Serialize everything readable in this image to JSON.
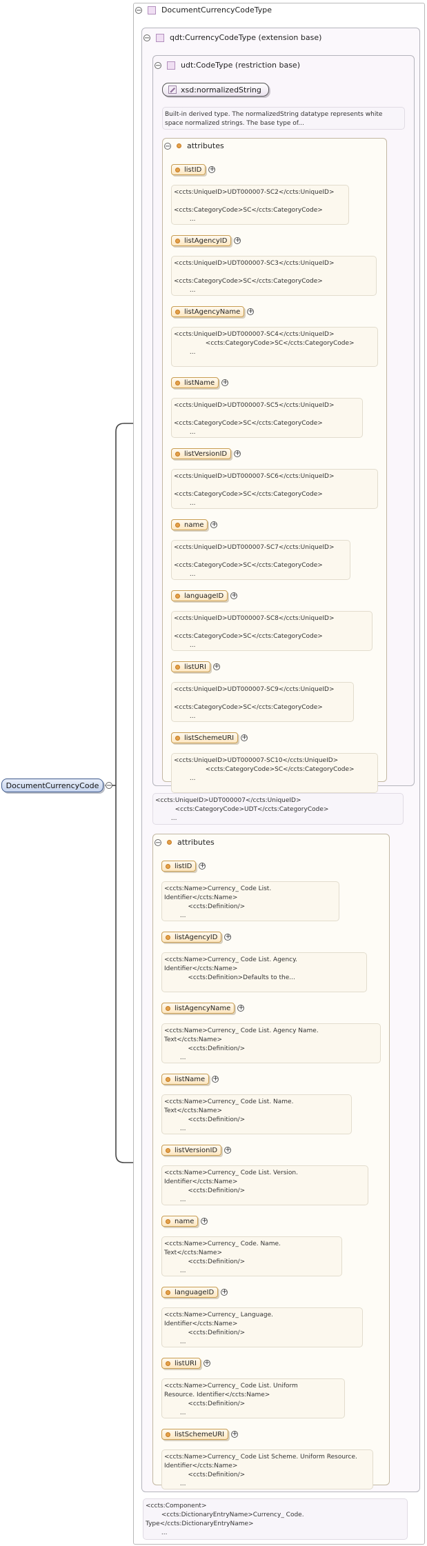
{
  "root": {
    "label": "DocumentCurrencyCode"
  },
  "main_type": {
    "label": "DocumentCurrencyCodeType"
  },
  "extension": {
    "label": "qdt:CurrencyCodeType (extension base)"
  },
  "restriction": {
    "label": "udt:CodeType (restriction base)"
  },
  "xsd": {
    "label": "xsd:normalizedString",
    "note": "Built-in derived type. The normalizedString datatype represents white\nspace normalized strings. The base type of..."
  },
  "inner_attributes": {
    "label": "attributes",
    "items": [
      {
        "name": "listID",
        "note": "<ccts:UniqueID>UDT000007-SC2</ccts:UniqueID>\n\n<ccts:CategoryCode>SC</ccts:CategoryCode>\n        ..."
      },
      {
        "name": "listAgencyID",
        "note": "<ccts:UniqueID>UDT000007-SC3</ccts:UniqueID>\n\n<ccts:CategoryCode>SC</ccts:CategoryCode>\n        ..."
      },
      {
        "name": "listAgencyName",
        "note": "<ccts:UniqueID>UDT000007-SC4</ccts:UniqueID>\n                <ccts:CategoryCode>SC</ccts:CategoryCode>\n        ..."
      },
      {
        "name": "listName",
        "note": "<ccts:UniqueID>UDT000007-SC5</ccts:UniqueID>\n\n<ccts:CategoryCode>SC</ccts:CategoryCode>\n        ..."
      },
      {
        "name": "listVersionID",
        "note": "<ccts:UniqueID>UDT000007-SC6</ccts:UniqueID>\n\n<ccts:CategoryCode>SC</ccts:CategoryCode>\n        ..."
      },
      {
        "name": "name",
        "note": "<ccts:UniqueID>UDT000007-SC7</ccts:UniqueID>\n\n<ccts:CategoryCode>SC</ccts:CategoryCode>\n        ..."
      },
      {
        "name": "languageID",
        "note": "<ccts:UniqueID>UDT000007-SC8</ccts:UniqueID>\n\n<ccts:CategoryCode>SC</ccts:CategoryCode>\n        ..."
      },
      {
        "name": "listURI",
        "note": "<ccts:UniqueID>UDT000007-SC9</ccts:UniqueID>\n\n<ccts:CategoryCode>SC</ccts:CategoryCode>\n        ..."
      },
      {
        "name": "listSchemeURI",
        "note": "<ccts:UniqueID>UDT000007-SC10</ccts:UniqueID>\n                <ccts:CategoryCode>SC</ccts:CategoryCode>\n        ..."
      }
    ]
  },
  "restriction_note": "<ccts:UniqueID>UDT000007</ccts:UniqueID>\n          <ccts:CategoryCode>UDT</ccts:CategoryCode>\n        ...",
  "outer_attributes": {
    "label": "attributes",
    "items": [
      {
        "name": "listID",
        "note": "<ccts:Name>Currency_ Code List.\nIdentifier</ccts:Name>\n            <ccts:Definition/>\n        ..."
      },
      {
        "name": "listAgencyID",
        "note": "<ccts:Name>Currency_ Code List. Agency.\nIdentifier</ccts:Name>\n            <ccts:Definition>Defaults to the...\n        "
      },
      {
        "name": "listAgencyName",
        "note": "<ccts:Name>Currency_ Code List. Agency Name.\nText</ccts:Name>\n            <ccts:Definition/>\n        ..."
      },
      {
        "name": "listName",
        "note": "<ccts:Name>Currency_ Code List. Name.\nText</ccts:Name>\n            <ccts:Definition/>\n        ..."
      },
      {
        "name": "listVersionID",
        "note": "<ccts:Name>Currency_ Code List. Version.\nIdentifier</ccts:Name>\n            <ccts:Definition/>\n        ..."
      },
      {
        "name": "name",
        "note": "<ccts:Name>Currency_ Code. Name.\nText</ccts:Name>\n            <ccts:Definition/>\n        ..."
      },
      {
        "name": "languageID",
        "note": "<ccts:Name>Currency_ Language.\nIdentifier</ccts:Name>\n            <ccts:Definition/>\n        ..."
      },
      {
        "name": "listURI",
        "note": "<ccts:Name>Currency_ Code List. Uniform\nResource. Identifier</ccts:Name>\n            <ccts:Definition/>\n        ..."
      },
      {
        "name": "listSchemeURI",
        "note": "<ccts:Name>Currency_ Code List Scheme. Uniform Resource.\nIdentifier</ccts:Name>\n            <ccts:Definition/>\n        ..."
      }
    ]
  },
  "component_note": "<ccts:Component>\n        <ccts:DictionaryEntryName>Currency_ Code.\nType</ccts:DictionaryEntryName>\n        ...",
  "icons": {
    "toggle": "collapse-minus-icon",
    "plus": "expand-plus-icon",
    "type": "complex-type-icon",
    "attribute": "attribute-icon",
    "simple": "simple-type-pencil-icon"
  }
}
